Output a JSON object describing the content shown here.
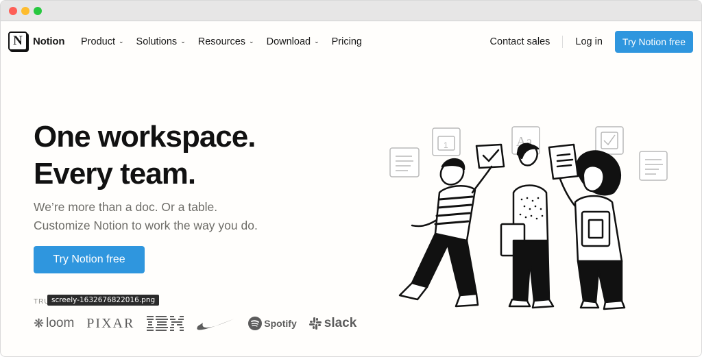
{
  "window": {
    "title": ""
  },
  "brand": {
    "logo_letter": "N",
    "name": "Notion"
  },
  "nav": {
    "items": [
      {
        "label": "Product",
        "has_dropdown": true
      },
      {
        "label": "Solutions",
        "has_dropdown": true
      },
      {
        "label": "Resources",
        "has_dropdown": true
      },
      {
        "label": "Download",
        "has_dropdown": true
      },
      {
        "label": "Pricing",
        "has_dropdown": false
      }
    ],
    "contact_sales": "Contact sales",
    "log_in": "Log in",
    "cta": "Try Notion free"
  },
  "hero": {
    "title_line1": "One workspace.",
    "title_line2": "Every team.",
    "subtitle_line1": "We’re more than a doc. Or a table.",
    "subtitle_line2": "Customize Notion to work the way you do.",
    "cta": "Try Notion free"
  },
  "trusted": {
    "label": "TRU"
  },
  "tooltip": {
    "text": "screely-1632676822016.png"
  },
  "logos": [
    {
      "name": "loom",
      "icon": "loom-burst-icon"
    },
    {
      "name": "PIXAR",
      "icon": "pixar-wordmark"
    },
    {
      "name": "IBM",
      "icon": "ibm-wordmark"
    },
    {
      "name": "",
      "icon": "nike-swoosh-icon"
    },
    {
      "name": "Spotify",
      "icon": "spotify-icon"
    },
    {
      "name": "slack",
      "icon": "slack-icon"
    }
  ],
  "colors": {
    "accent": "#2f96de",
    "text": "#191919",
    "muted": "#6f6e69",
    "background": "#fffefc"
  },
  "illustration": {
    "description_icon": "team-illustration-icon"
  }
}
